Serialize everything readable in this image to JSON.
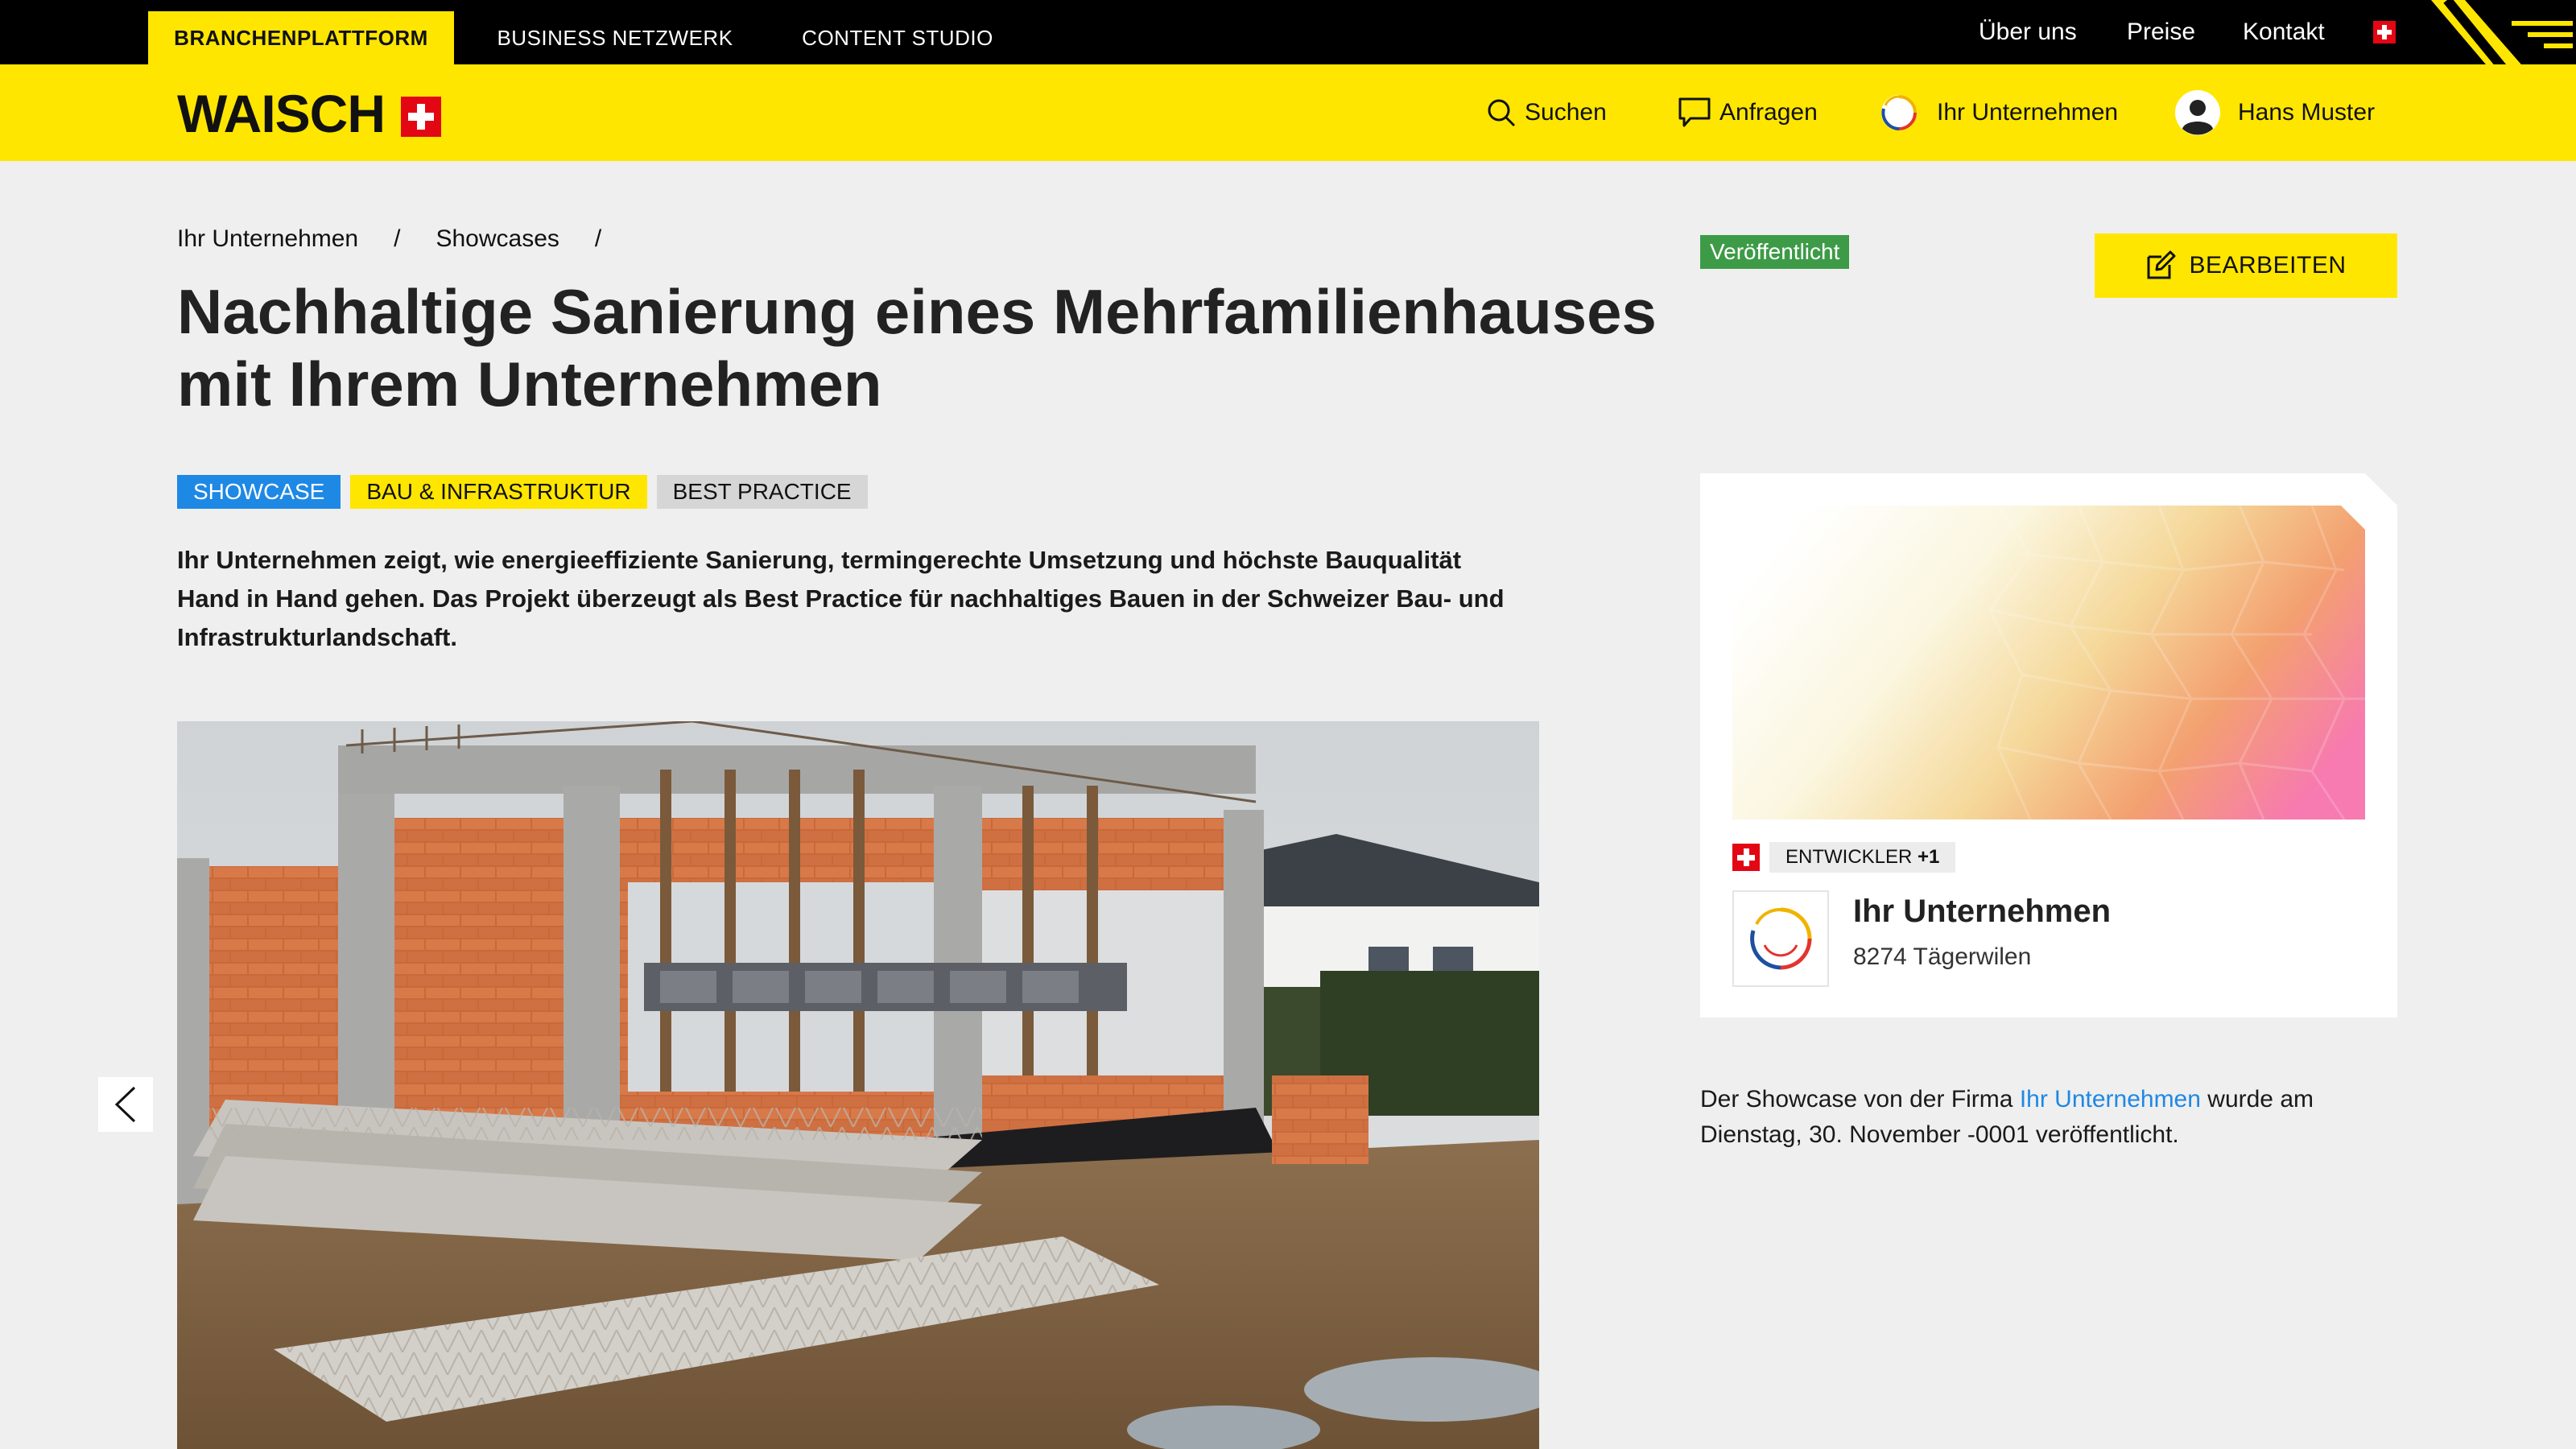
{
  "top_nav": {
    "tabs": [
      "BRANCHENPLATTFORM",
      "BUSINESS NETZWERK",
      "CONTENT STUDIO"
    ],
    "links": [
      "Über uns",
      "Preise",
      "Kontakt"
    ]
  },
  "header": {
    "logo_text": "WAISCH",
    "nav": {
      "search": "Suchen",
      "requests": "Anfragen",
      "company": "Ihr Unternehmen",
      "user": "Hans Muster"
    }
  },
  "breadcrumb": {
    "items": [
      "Ihr Unternehmen",
      "Showcases"
    ],
    "separator": "/"
  },
  "page": {
    "title": "Nachhaltige Sanierung eines Mehrfamilienhauses mit Ihrem Unternehmen",
    "tags": [
      "SHOWCASE",
      "BAU & INFRASTRUKTUR",
      "BEST PRACTICE"
    ],
    "lead": "Ihr Unternehmen zeigt, wie energieeffiziente Sanierung, termingerechte Umsetzung und höchste Bauqualität Hand in Hand gehen. Das Projekt überzeugt als Best Practice für nachhaltiges Bauen in der Schweizer Bau- und Infrastrukturlandschaft."
  },
  "sidebar": {
    "status": "Veröffentlicht",
    "edit_label": "BEARBEITEN",
    "card": {
      "badge_label": "ENTWICKLER",
      "badge_extra": "+1",
      "company_name": "Ihr Unternehmen",
      "location": "8274 Tägerwilen"
    },
    "note": {
      "prefix": "Der Showcase von der Firma ",
      "link": "Ihr Unternehmen",
      "suffix": " wurde am Dienstag, 30. November -0001 veröffentlicht."
    }
  },
  "colors": {
    "brand_yellow": "#ffe600",
    "link_blue": "#1e88e5",
    "status_green": "#3d9b47",
    "swiss_red": "#e30613"
  }
}
